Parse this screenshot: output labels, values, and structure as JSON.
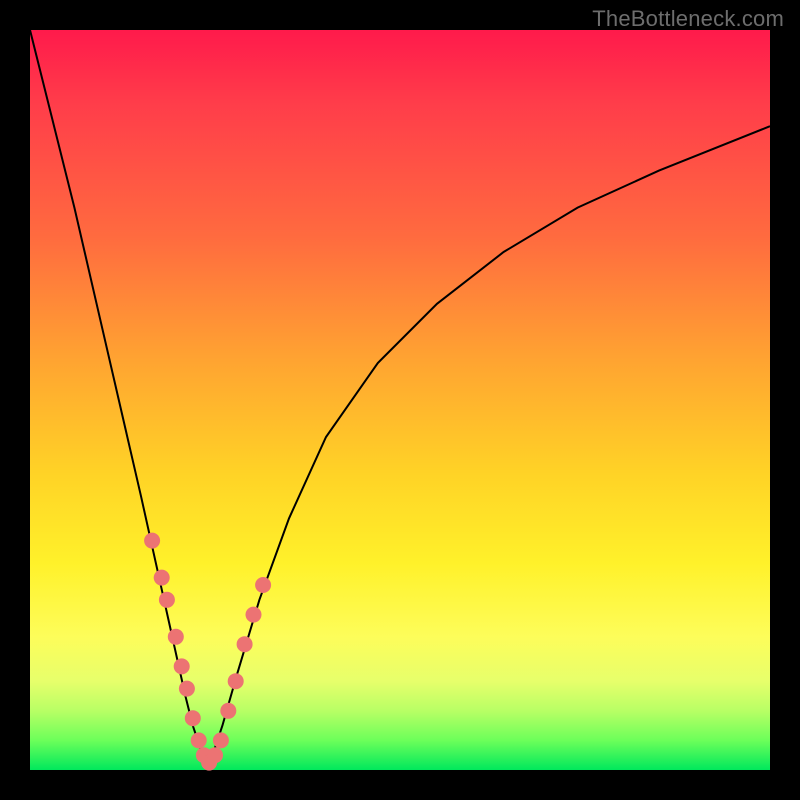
{
  "watermark": "TheBottleneck.com",
  "colors": {
    "frame": "#000000",
    "dot": "#ec7373",
    "curve": "#000000",
    "gradient_top": "#ff1a4b",
    "gradient_bottom": "#00e85c"
  },
  "chart_data": {
    "type": "line",
    "title": "",
    "xlabel": "",
    "ylabel": "",
    "xlim": [
      0,
      100
    ],
    "ylim": [
      0,
      100
    ],
    "note": "Values estimated from pixels; axes unlabeled. y≈0 is bottom (green), y≈100 is top (red). x≈0 left, x≈100 right. Minimum of V at roughly x≈24.",
    "series": [
      {
        "name": "left-branch",
        "x": [
          0,
          3,
          6,
          9,
          12,
          15,
          17,
          19,
          21,
          22,
          23,
          24
        ],
        "values": [
          100,
          88,
          76,
          63,
          50,
          37,
          28,
          19,
          10,
          6,
          3,
          0
        ]
      },
      {
        "name": "right-branch",
        "x": [
          24,
          26,
          28,
          31,
          35,
          40,
          47,
          55,
          64,
          74,
          85,
          100
        ],
        "values": [
          0,
          6,
          13,
          23,
          34,
          45,
          55,
          63,
          70,
          76,
          81,
          87
        ]
      }
    ],
    "scatter": {
      "name": "highlighted-points",
      "x": [
        16.5,
        17.8,
        18.5,
        19.7,
        20.5,
        21.2,
        22.0,
        22.8,
        23.5,
        24.2,
        25.0,
        25.8,
        26.8,
        27.8,
        29.0,
        30.2,
        31.5
      ],
      "values": [
        31,
        26,
        23,
        18,
        14,
        11,
        7,
        4,
        2,
        1,
        2,
        4,
        8,
        12,
        17,
        21,
        25
      ]
    }
  }
}
